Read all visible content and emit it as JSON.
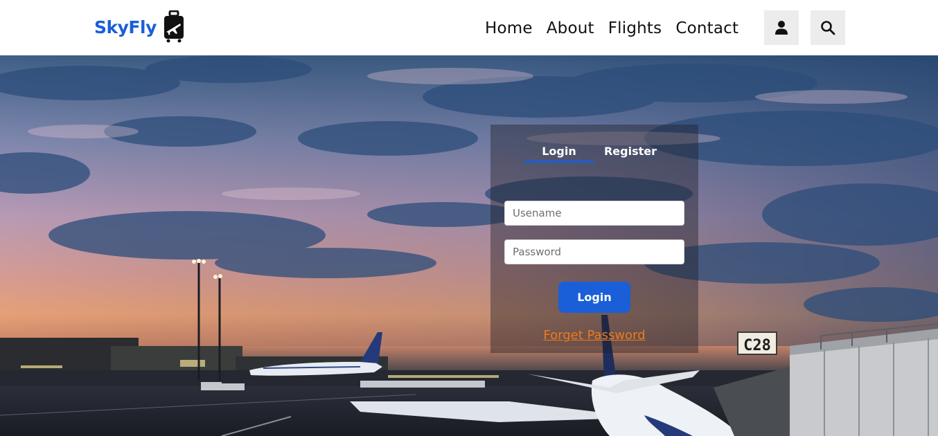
{
  "brand": {
    "name": "SkyFly",
    "logo_icon": "luggage-plane-icon",
    "color": "#1a5fd8"
  },
  "nav": {
    "links": [
      {
        "label": "Home"
      },
      {
        "label": "About"
      },
      {
        "label": "Flights"
      },
      {
        "label": "Contact"
      }
    ],
    "user_icon": "user-icon",
    "search_icon": "search-icon"
  },
  "auth": {
    "tabs": [
      {
        "label": "Login",
        "active": true
      },
      {
        "label": "Register",
        "active": false
      }
    ],
    "username_placeholder": "Usename",
    "password_placeholder": "Password",
    "login_button": "Login",
    "forget_link": "Forget Password"
  },
  "hero": {
    "gate_sign": "C28"
  },
  "colors": {
    "accent": "#1a5fd8",
    "link": "#f07a1a",
    "icon_button_bg": "#ececec"
  }
}
